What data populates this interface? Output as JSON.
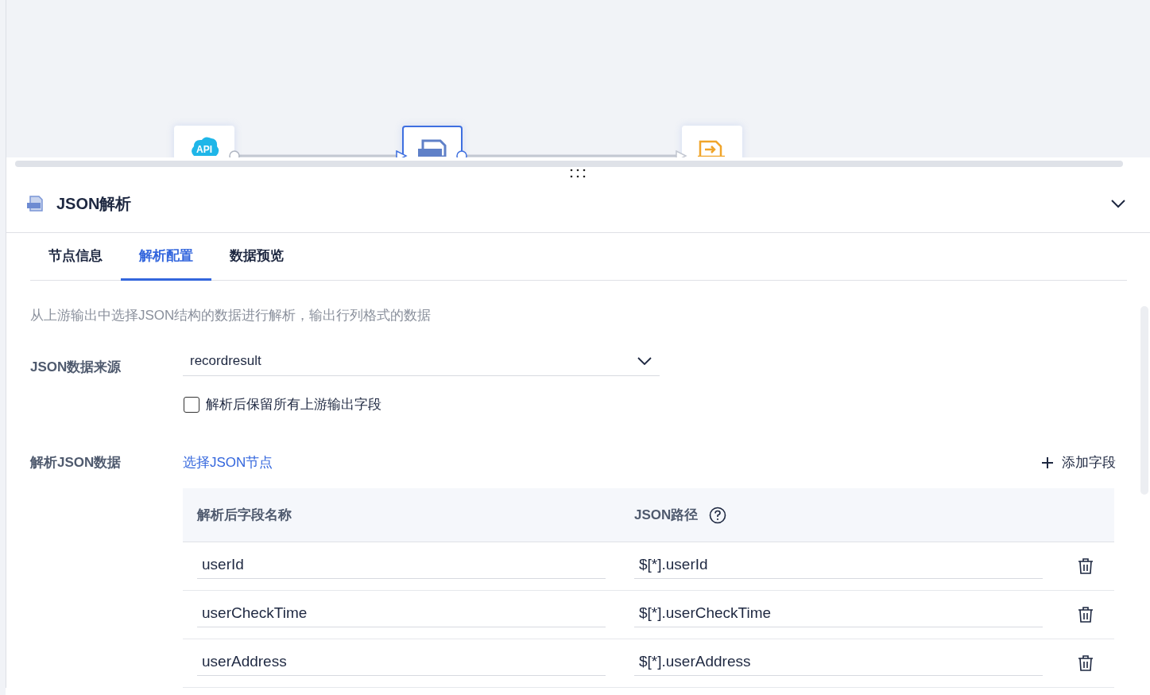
{
  "canvas": {
    "nodes": [
      {
        "kind": "api",
        "label": "API",
        "selected": false
      },
      {
        "kind": "json",
        "selected": true
      },
      {
        "kind": "output",
        "selected": false
      }
    ]
  },
  "panel": {
    "title": "JSON解析",
    "expanded": true,
    "tabs": [
      {
        "label": "节点信息",
        "selected": false
      },
      {
        "label": "解析配置",
        "selected": true
      },
      {
        "label": "数据预览",
        "selected": false
      }
    ],
    "description": "从上游输出中选择JSON结构的数据进行解析，输出行列格式的数据",
    "source": {
      "label": "JSON数据来源",
      "value": "recordresult"
    },
    "keep_fields": {
      "label": "解析后保留所有上游输出字段",
      "checked": false
    },
    "parse": {
      "label": "解析JSON数据",
      "select_link": "选择JSON节点",
      "add_button": "添加字段"
    },
    "table": {
      "columns": [
        "解析后字段名称",
        "JSON路径"
      ],
      "rows": [
        {
          "name": "userId",
          "path": "$[*].userId"
        },
        {
          "name": "userCheckTime",
          "path": "$[*].userCheckTime"
        },
        {
          "name": "userAddress",
          "path": "$[*].userAddress"
        }
      ]
    }
  }
}
